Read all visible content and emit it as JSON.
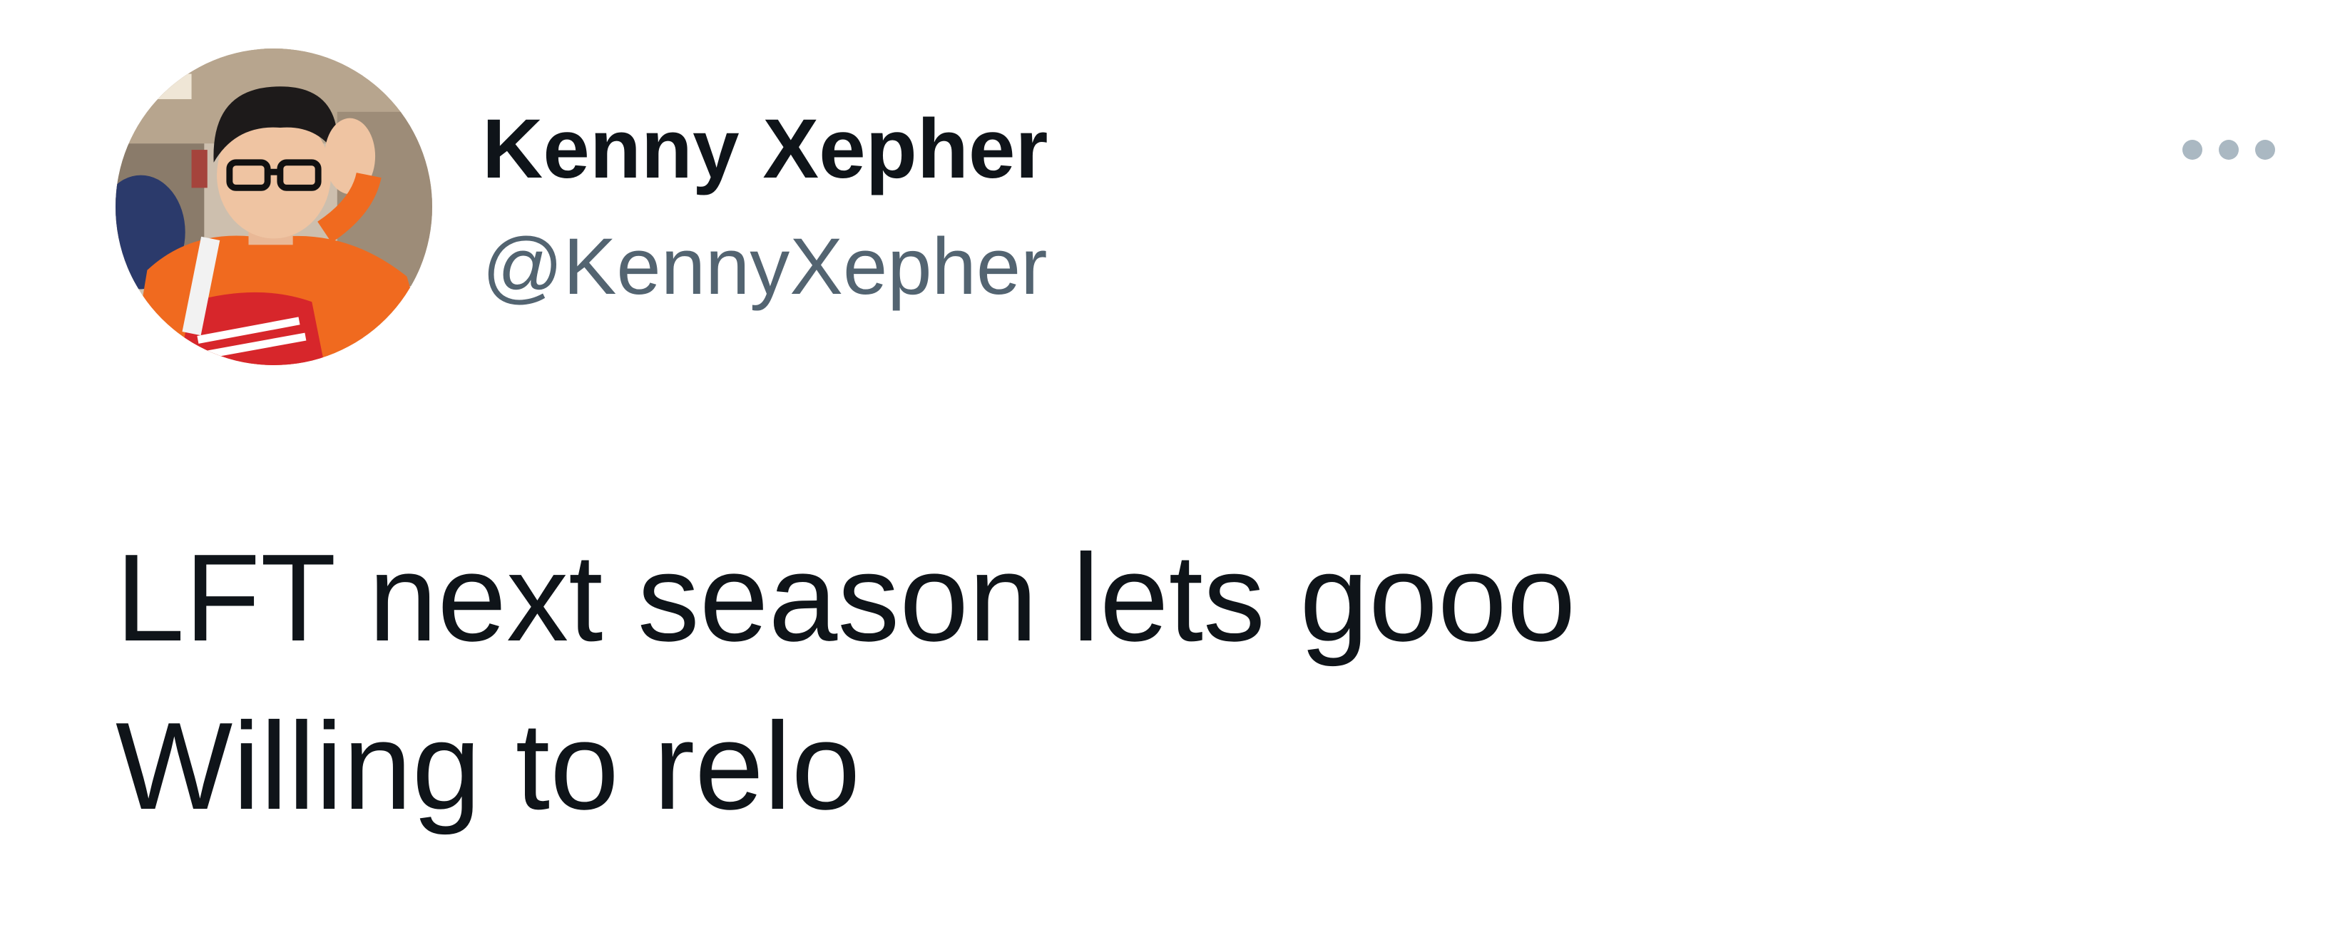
{
  "author": {
    "display_name": "Kenny Xepher",
    "handle": "@KennyXepher"
  },
  "tweet": {
    "lines": [
      "LFT next season lets gooo",
      "Willing to relo"
    ]
  },
  "colors": {
    "name": "#0f1419",
    "handle": "#536471",
    "more_dots": "#aab8c2"
  },
  "icons": {
    "more": "more-horizontal-icon"
  }
}
